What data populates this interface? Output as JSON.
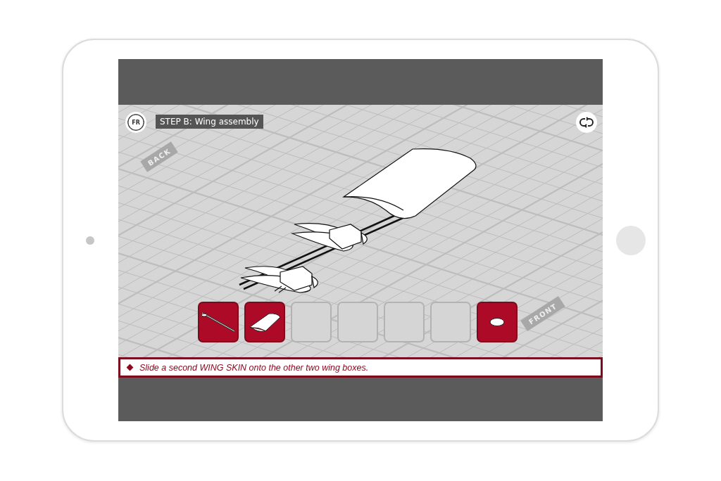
{
  "header": {
    "language_button": "FR",
    "step_title": "STEP B: Wing assembly"
  },
  "floor_labels": {
    "back": "BACK",
    "front": "FRONT"
  },
  "parts_tray": [
    {
      "kind": "rod",
      "filled": true
    },
    {
      "kind": "skin",
      "filled": true
    },
    {
      "filled": false
    },
    {
      "filled": false
    },
    {
      "filled": false
    },
    {
      "filled": false
    },
    {
      "kind": "rib",
      "filled": true
    }
  ],
  "instruction": {
    "text": "Slide a second WING SKIN onto the other two wing boxes."
  }
}
